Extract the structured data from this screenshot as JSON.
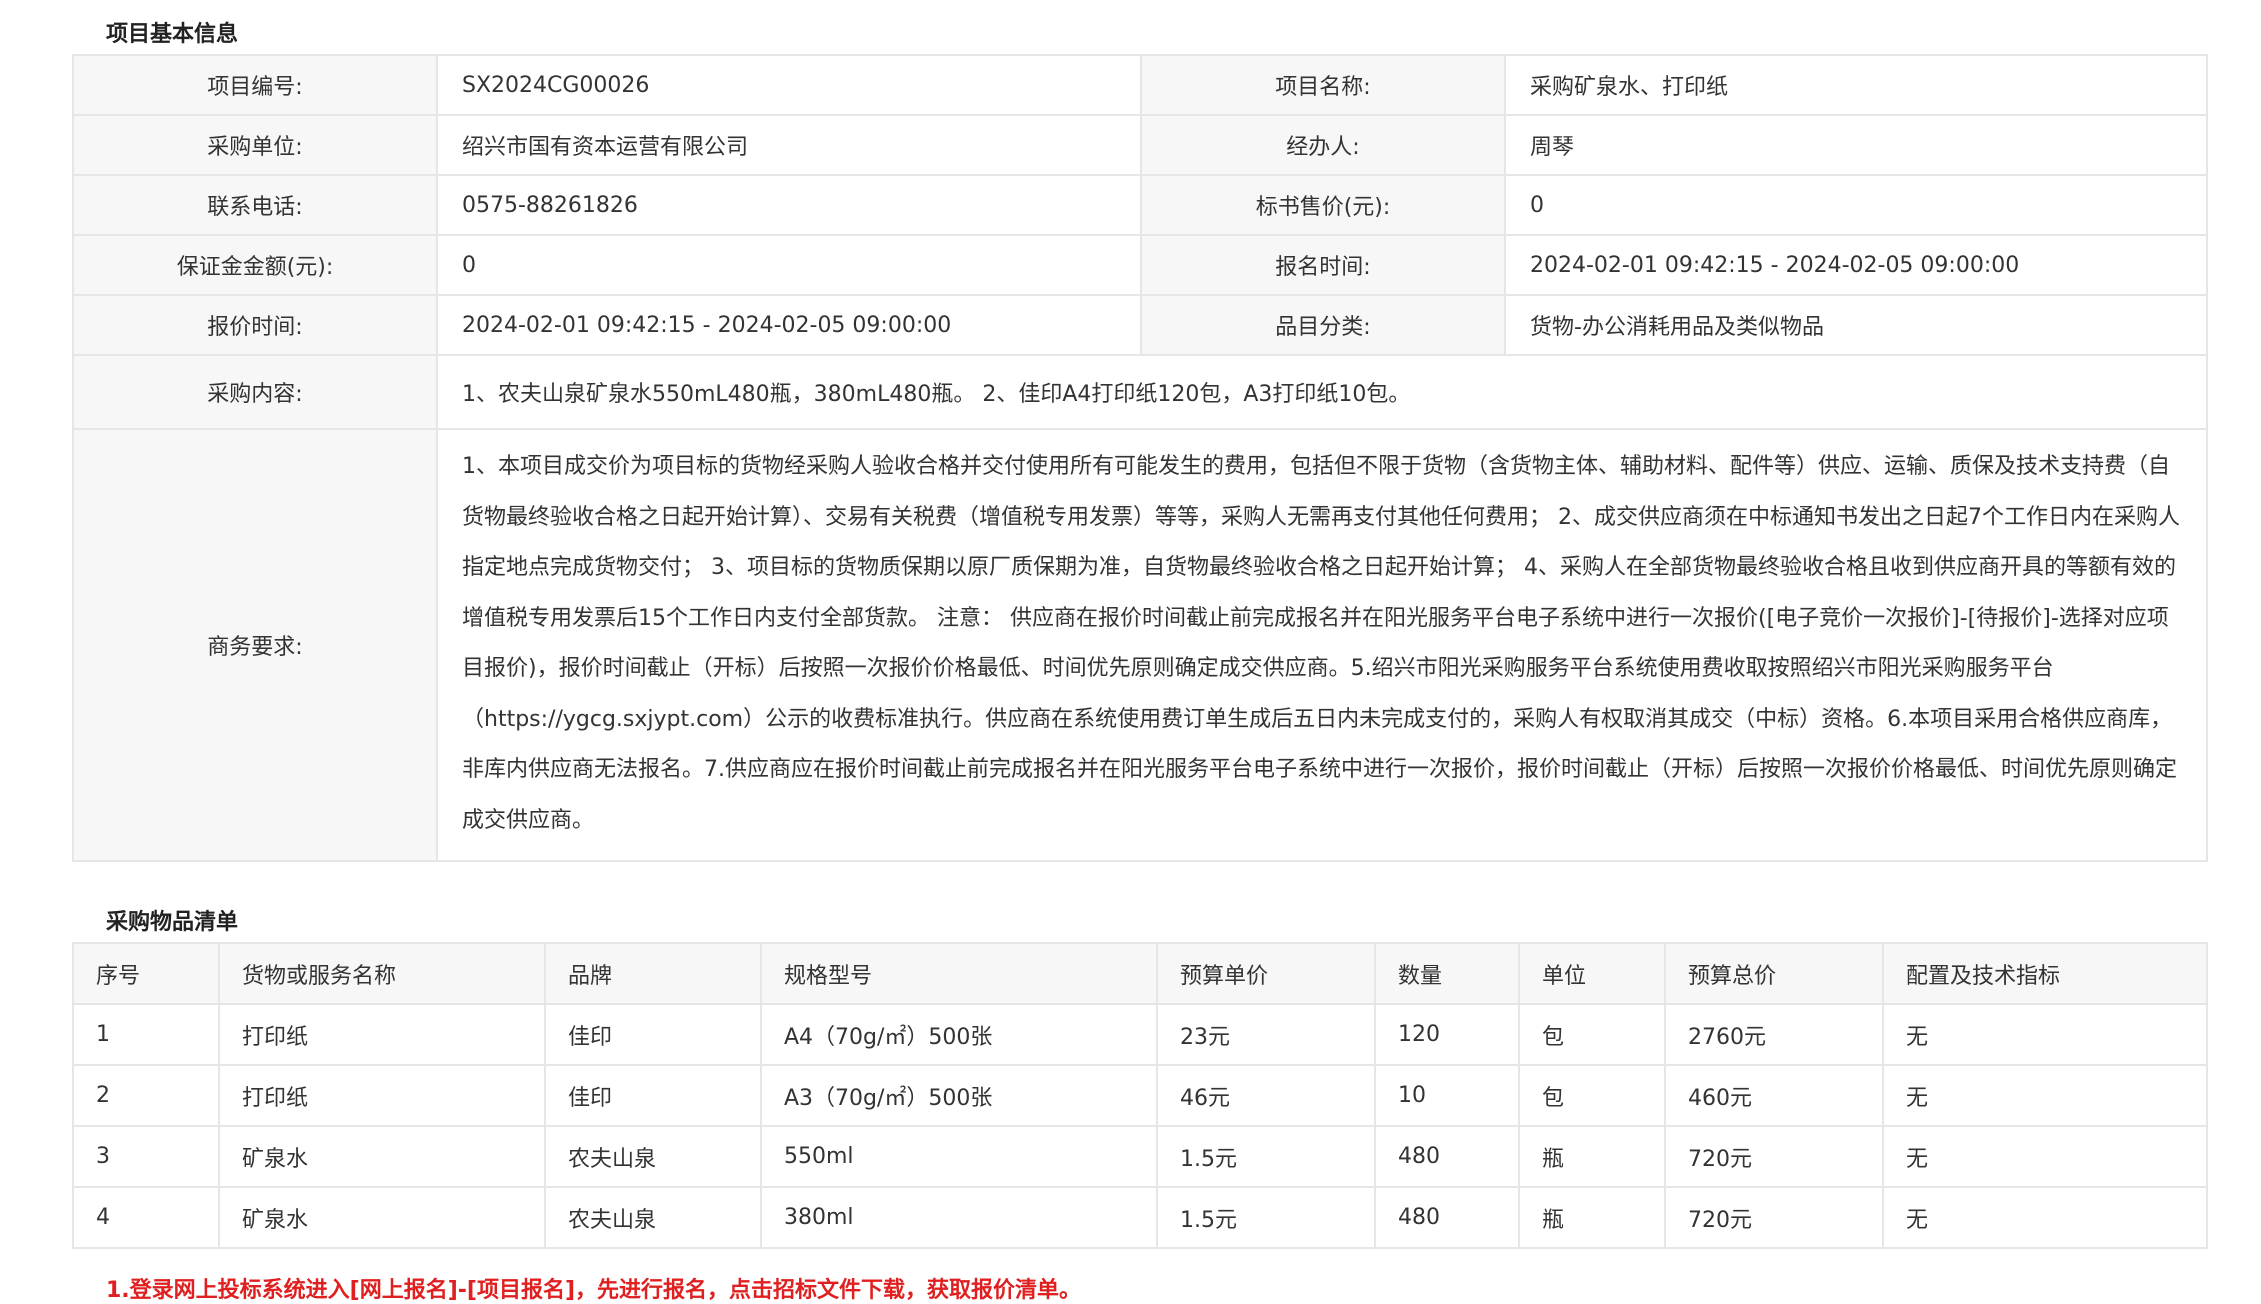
{
  "basic_info": {
    "section_title": "项目基本信息",
    "project_no_label": "项目编号:",
    "project_no": "SX2024CG00026",
    "project_name_label": "项目名称:",
    "project_name": "采购矿泉水、打印纸",
    "buyer_label": "采购单位:",
    "buyer": "绍兴市国有资本运营有限公司",
    "handler_label": "经办人:",
    "handler": "周琴",
    "phone_label": "联系电话:",
    "phone": "0575-88261826",
    "doc_price_label": "标书售价(元):",
    "doc_price": "0",
    "deposit_label": "保证金金额(元):",
    "deposit": "0",
    "signup_time_label": "报名时间:",
    "signup_time": "2024-02-01 09:42:15 - 2024-02-05 09:00:00",
    "quote_time_label": "报价时间:",
    "quote_time": "2024-02-01 09:42:15 - 2024-02-05 09:00:00",
    "category_label": "品目分类:",
    "category": "货物-办公消耗用品及类似物品",
    "content_label": "采购内容:",
    "content": "1、农夫山泉矿泉水550mL480瓶，380mL480瓶。 2、佳印A4打印纸120包，A3打印纸10包。",
    "business_label": "商务要求:",
    "business": "1、本项目成交价为项目标的货物经采购人验收合格并交付使用所有可能发生的费用，包括但不限于货物（含货物主体、辅助材料、配件等）供应、运输、质保及技术支持费（自货物最终验收合格之日起开始计算）、交易有关税费（增值税专用发票）等等，采购人无需再支付其他任何费用； 2、成交供应商须在中标通知书发出之日起7个工作日内在采购人指定地点完成货物交付； 3、项目标的货物质保期以原厂质保期为准，自货物最终验收合格之日起开始计算； 4、采购人在全部货物最终验收合格且收到供应商开具的等额有效的增值税专用发票后15个工作日内支付全部货款。 注意： 供应商在报价时间截止前完成报名并在阳光服务平台电子系统中进行一次报价([电子竞价一次报价]-[待报价]-选择对应项目报价)，报价时间截止（开标）后按照一次报价价格最低、时间优先原则确定成交供应商。5.绍兴市阳光采购服务平台系统使用费收取按照绍兴市阳光采购服务平台（https://ygcg.sxjypt.com）公示的收费标准执行。供应商在系统使用费订单生成后五日内未完成支付的，采购人有权取消其成交（中标）资格。6.本项目采用合格供应商库，非库内供应商无法报名。7.供应商应在报价时间截止前完成报名并在阳光服务平台电子系统中进行一次报价，报价时间截止（开标）后按照一次报价价格最低、时间优先原则确定成交供应商。"
  },
  "items": {
    "section_title": "采购物品清单",
    "headers": [
      "序号",
      "货物或服务名称",
      "品牌",
      "规格型号",
      "预算单价",
      "数量",
      "单位",
      "预算总价",
      "配置及技术指标"
    ],
    "rows": [
      [
        "1",
        "打印纸",
        "佳印",
        "A4（70g/㎡）500张",
        "23元",
        "120",
        "包",
        "2760元",
        "无"
      ],
      [
        "2",
        "打印纸",
        "佳印",
        "A3（70g/㎡）500张",
        "46元",
        "10",
        "包",
        "460元",
        "无"
      ],
      [
        "3",
        "矿泉水",
        "农夫山泉",
        "550ml",
        "1.5元",
        "480",
        "瓶",
        "720元",
        "无"
      ],
      [
        "4",
        "矿泉水",
        "农夫山泉",
        "380ml",
        "1.5元",
        "480",
        "瓶",
        "720元",
        "无"
      ]
    ]
  },
  "notice": "1.登录网上投标系统进入[网上报名]-[项目报名]，先进行报名，点击招标文件下载，获取报价清单。",
  "colors": {
    "label_bg": "#f7f7f7",
    "border": "#e6e6e6",
    "notice": "#e02020"
  }
}
